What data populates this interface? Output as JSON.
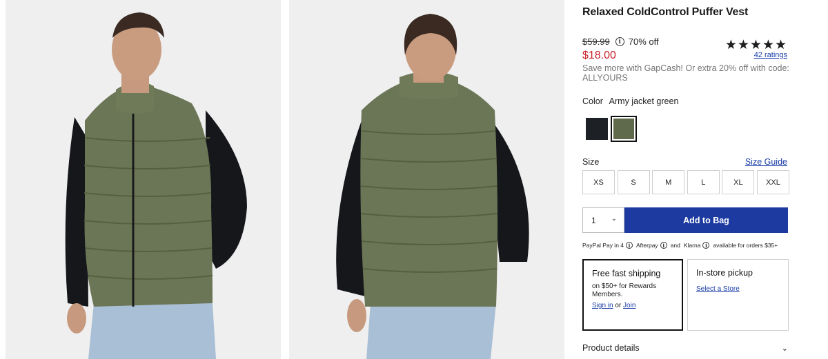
{
  "product": {
    "title": "Relaxed ColdControl Puffer Vest",
    "original_price": "$59.99",
    "discount": "70% off",
    "sale_price": "$18.00",
    "stars": "★★★★★",
    "rating_value": 5,
    "ratings_count": "42 ratings",
    "promo": "Save more with GapCash! Or extra 20% off with code: ALLYOURS"
  },
  "color": {
    "label": "Color",
    "selected": "Army jacket green",
    "swatches": [
      {
        "name": "black",
        "hex": "#1d2126"
      },
      {
        "name": "Army jacket green",
        "hex": "#5f6a4d",
        "selected": true
      }
    ]
  },
  "size": {
    "label": "Size",
    "guide": "Size Guide",
    "options": [
      "XS",
      "S",
      "M",
      "L",
      "XL",
      "XXL"
    ]
  },
  "purchase": {
    "quantity": "1",
    "add_to_bag": "Add to Bag"
  },
  "bnpl": {
    "paypal": "PayPal Pay in 4",
    "afterpay": "Afterpay",
    "and": "and",
    "klarna": "Klarna",
    "tail": "available for orders $35+"
  },
  "shipping": {
    "fast_title": "Free fast shipping",
    "fast_sub": "on $50+ for Rewards Members.",
    "sign_in": "Sign in",
    "or": "or",
    "join": "Join",
    "pickup_title": "In-store pickup",
    "select_store": "Select a Store"
  },
  "details": {
    "label": "Product details"
  },
  "icons": {
    "info": "i",
    "chevron": "⌄"
  },
  "colors": {
    "accent": "#1c3aa0",
    "sale": "#c8202a",
    "link": "#1a3ea8"
  }
}
